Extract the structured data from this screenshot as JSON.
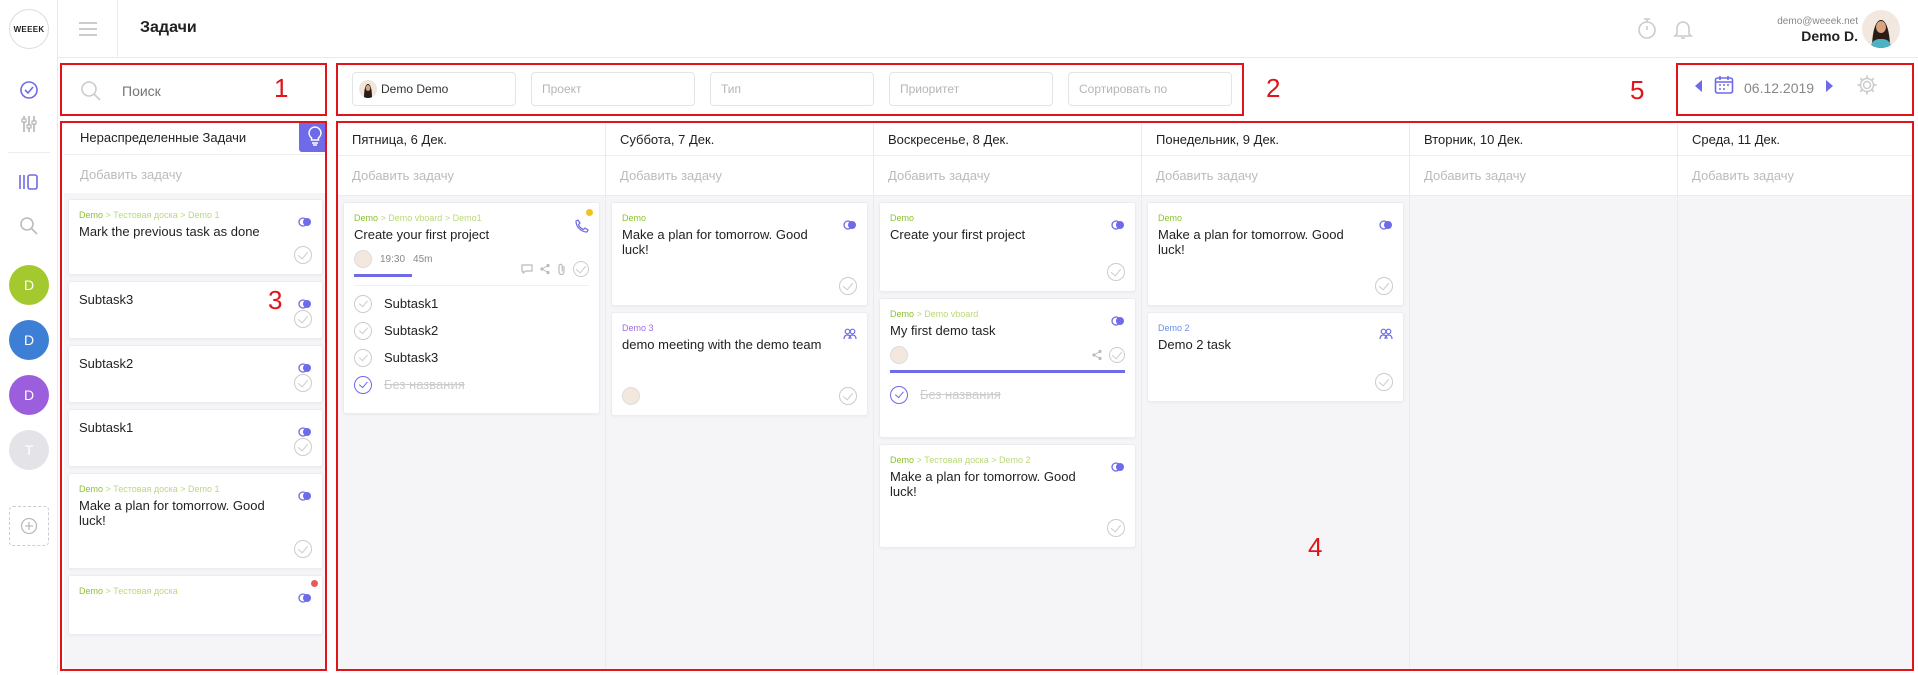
{
  "logo": {
    "text": "WEEEK"
  },
  "header": {
    "title": "Задачи"
  },
  "user": {
    "email": "demo@weeek.net",
    "name": "Demo D."
  },
  "projects": [
    {
      "letter": "D",
      "color": "#a3c92f"
    },
    {
      "letter": "D",
      "color": "#3e7fd6"
    },
    {
      "letter": "D",
      "color": "#9b5fde"
    },
    {
      "letter": "T",
      "color": "#e4e4e8"
    }
  ],
  "search": {
    "placeholder": "Поиск"
  },
  "filters": {
    "user": "Demo Demo",
    "project": "Проект",
    "type": "Тип",
    "priority": "Приоритет",
    "sort": "Сортировать по"
  },
  "date_nav": {
    "date": "06.12.2019"
  },
  "annotations": [
    "1",
    "2",
    "3",
    "4",
    "5"
  ],
  "unassigned": {
    "title": "Нераспределенные Задачи",
    "add_task": "Добавить задачу",
    "cards": [
      {
        "p1": "Demo",
        "sep1": " > ",
        "p2": "Тестовая доска",
        "sep2": " > ",
        "p3": "Demo 1",
        "title": "Mark the previous task as done"
      },
      {
        "title": "Subtask3"
      },
      {
        "title": "Subtask2"
      },
      {
        "title": "Subtask1"
      },
      {
        "p1": "Demo",
        "sep1": " > ",
        "p2": "Тестовая доска",
        "sep2": " > ",
        "p3": "Demo 1",
        "title": "Make a plan for tomorrow. Good luck!"
      },
      {
        "p1": "Demo",
        "sep1": " > ",
        "p2": "Тестовая доска"
      }
    ]
  },
  "days": [
    {
      "title": "Пятница, 6 Дек.",
      "add_task": "Добавить задачу",
      "card": {
        "p1": "Demo",
        "sep1": " > ",
        "p2": "Demo vboard",
        "sep2": " > ",
        "p3": "Demo1",
        "title": "Create your first project",
        "time": "19:30",
        "duration": "45m",
        "subtasks": [
          "Subtask1",
          "Subtask2",
          "Subtask3"
        ],
        "done_subtask": "Без названия"
      }
    },
    {
      "title": "Суббота, 7 Дек.",
      "add_task": "Добавить задачу",
      "cards": [
        {
          "p1": "Demo",
          "title": "Make a plan for tomorrow. Good luck!"
        },
        {
          "p1": "Demo 3",
          "title": "demo meeting with the demo team"
        }
      ]
    },
    {
      "title": "Воскресенье, 8 Дек.",
      "add_task": "Добавить задачу",
      "cards": [
        {
          "p1": "Demo",
          "title": "Create your first project"
        },
        {
          "p1": "Demo",
          "sep1": " > ",
          "p2": "Demo vboard",
          "title": "My first demo task",
          "done_subtask": "Без названия"
        },
        {
          "p1": "Demo",
          "sep1": " > ",
          "p2": "Тестовая доска",
          "sep2": " > ",
          "p3": "Demo 2",
          "title": "Make a plan for tomorrow. Good luck!"
        }
      ]
    },
    {
      "title": "Понедельник, 9 Дек.",
      "add_task": "Добавить задачу",
      "cards": [
        {
          "p1": "Demo",
          "title": "Make a plan for tomorrow. Good luck!"
        },
        {
          "p1": "Demo 2",
          "title": "Demo 2 task"
        }
      ]
    },
    {
      "title": "Вторник, 10 Дек.",
      "add_task": "Добавить задачу"
    },
    {
      "title": "Среда, 11 Дек.",
      "add_task": "Добавить задачу"
    }
  ],
  "colors": {
    "accent": "#6e6ae8",
    "project_green": "#8cc233",
    "annotation_red": "#e0141a"
  }
}
